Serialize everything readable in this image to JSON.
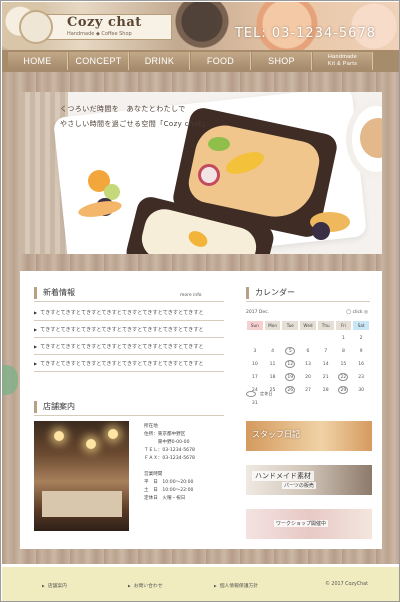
{
  "header": {
    "logo_title": "Cozy chat",
    "logo_subtitle": "Handmade  ◆  Coffee Shop",
    "phone": "TEL: 03-1234-5678"
  },
  "nav": {
    "items": [
      {
        "label": "HOME"
      },
      {
        "label": "CONCEPT"
      },
      {
        "label": "DRINK"
      },
      {
        "label": "FOOD"
      },
      {
        "label": "SHOP"
      },
      {
        "label_line1": "Handmade",
        "label_line2": "Kit & Parts"
      }
    ]
  },
  "hero": {
    "line1": "くつろいだ時間を　あなたとわたしで",
    "line2": "やさしい時間を過ごせる空間「Cozy chat」"
  },
  "news": {
    "title": "新着情報",
    "more": "more info",
    "items": [
      "てきすとてきすとてきすとてきすとてきすとてきすとてきすとてきすと",
      "てきすとてきすとてきすとてきすとてきすとてきすとてきすとてきすと",
      "てきすとてきすとてきすとてきすとてきすとてきすとてきすとてきすと",
      "てきすとてきすとてきすとてきすとてきすとてきすとてきすとてきすと"
    ]
  },
  "calendar": {
    "title": "カレンダー",
    "month": "2017 Dec.",
    "nav": "◯  click ◎",
    "days_of_week": [
      "Sun",
      "Mon",
      "Tue",
      "Wed",
      "Thu",
      "Fri",
      "Sat"
    ],
    "weeks": [
      [
        "",
        "",
        "",
        "",
        "",
        "1",
        "2"
      ],
      [
        "3",
        "4",
        "5",
        "6",
        "7",
        "8",
        "9"
      ],
      [
        "10",
        "11",
        "12",
        "13",
        "14",
        "15",
        "16"
      ],
      [
        "17",
        "18",
        "19",
        "20",
        "21",
        "22",
        "23"
      ],
      [
        "24",
        "25",
        "26",
        "27",
        "28",
        "29",
        "30"
      ],
      [
        "31",
        "",
        "",
        "",
        "",
        "",
        ""
      ]
    ],
    "marked": [
      "5",
      "12",
      "19",
      "26",
      "22",
      "29"
    ],
    "legend": "定休日"
  },
  "shop": {
    "title": "店舗案内",
    "info": "所在地\n住所：東京都中野区\n　　　東中野0-00-00\nＴＥＬ：03-1234-5678\nＦＡＸ：03-1234-5678\n\n営業時間\n平　日　10:00～20:00\n土　日　10:00～22:00\n定休日　火曜・祝日"
  },
  "banners": [
    {
      "label": "スタッフ日記"
    },
    {
      "label": "ハンドメイド素材",
      "sub": "パーツの販売"
    },
    {
      "label": "ワークショップ開催中"
    }
  ],
  "footer": {
    "links": [
      "店舗案内",
      "お問い合わせ",
      "個人情報保護方針"
    ],
    "copyright": "© 2017 CozyChat"
  }
}
